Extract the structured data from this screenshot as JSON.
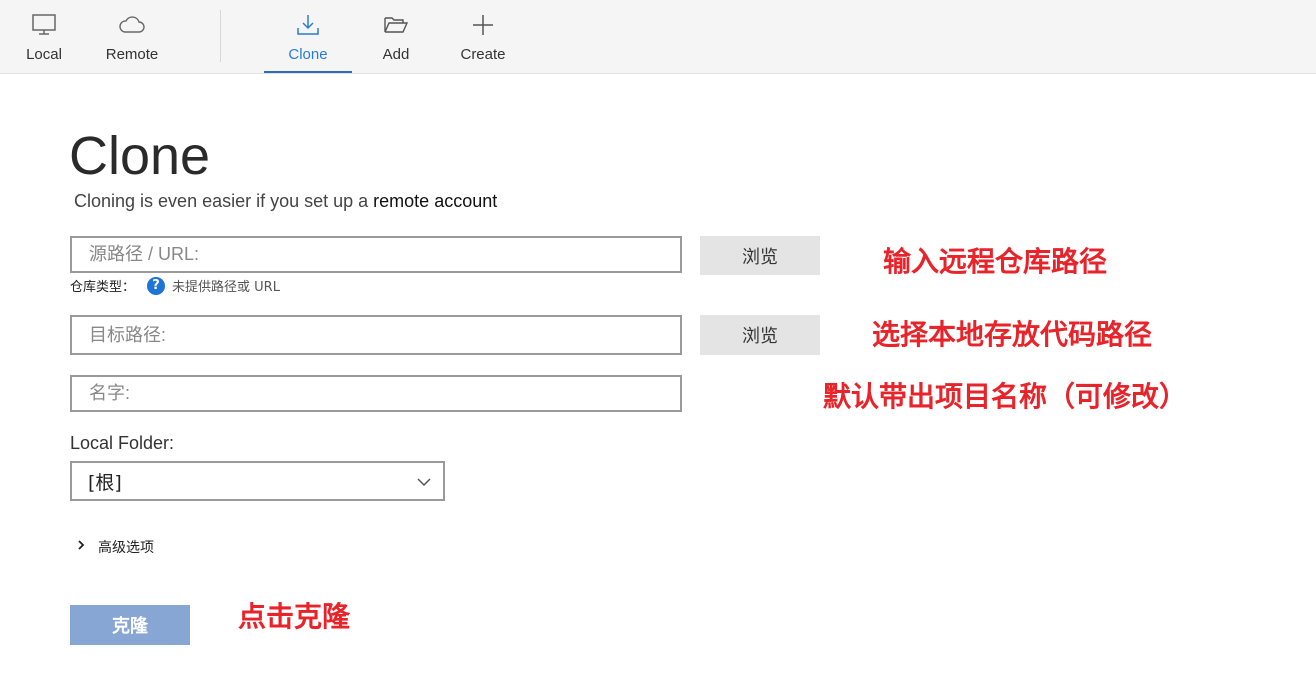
{
  "toolbar": {
    "items": [
      {
        "label": "Local",
        "icon": "monitor-icon"
      },
      {
        "label": "Remote",
        "icon": "cloud-icon"
      },
      {
        "label": "Clone",
        "icon": "download-icon",
        "active": true
      },
      {
        "label": "Add",
        "icon": "folder-open-icon"
      },
      {
        "label": "Create",
        "icon": "plus-icon"
      }
    ]
  },
  "main": {
    "title": "Clone",
    "subtitle_prefix": "Cloning is even easier if you set up a ",
    "subtitle_link": "remote account",
    "source_placeholder": "源路径 / URL:",
    "browse_label": "浏览",
    "repo_type_label": "仓库类型：",
    "repo_type_hint": "未提供路径或 URL",
    "dest_placeholder": "目标路径:",
    "name_placeholder": "名字:",
    "local_folder_label": "Local Folder:",
    "local_folder_value": "[根]",
    "advanced_label": "高级选项",
    "clone_button": "克隆"
  },
  "annotations": {
    "source": "输入远程仓库路径",
    "dest": "选择本地存放代码路径",
    "name": "默认带出项目名称（可修改）",
    "clone": "点击克隆"
  },
  "colors": {
    "accent": "#2b7cd3",
    "annotation": "#e8232a",
    "clone_button": "#87a6d4"
  }
}
